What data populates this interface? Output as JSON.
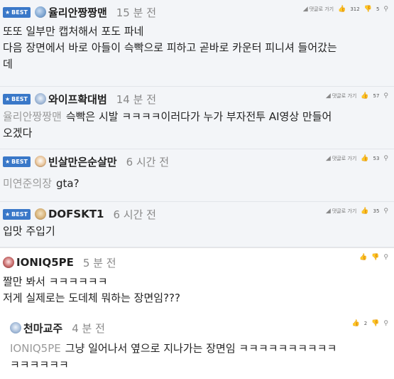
{
  "badge": {
    "label": "BEST",
    "star": "★"
  },
  "actions_labels": {
    "reply": "댓글로 가기"
  },
  "comments": [
    {
      "nick": "율리안짱짱맨",
      "time": "15 분 전",
      "reply_label": "댓글로 가기",
      "likes": "312",
      "dislikes": "5",
      "lines": [
        "또또 일부만 캡처해서 포도 파네",
        "다음 장면에서 바로 아들이 슥빡으로 피하고 곧바로 카운터 피니셔 들어갔는",
        "데"
      ]
    },
    {
      "nick": "와이프확대범",
      "time": "14 분 전",
      "reply_label": "댓글로 가기",
      "likes": "57",
      "mention": "율리안짱짱맨",
      "lines": [
        "슥빡은 시발 ㅋㅋㅋㅋ이러다가 누가 부자전투 AI영상 만들어",
        "오겠다"
      ]
    },
    {
      "nick": "빈살만은순살만",
      "time": "6 시간 전",
      "reply_label": "댓글로 가기",
      "likes": "53",
      "mention": "미연준의장",
      "lines": [
        "gta?"
      ]
    },
    {
      "nick": "DOFSKT1",
      "time": "6 시간 전",
      "reply_label": "댓글로 가기",
      "likes": "35",
      "lines": [
        "입맛 주입기"
      ]
    },
    {
      "nick": "IONIQ5PE",
      "time": "5 분 전",
      "lines": [
        "짤만 봐서 ㅋㅋㅋㅋㅋㅋ",
        "저게 실제로는 도데체 뭐하는 장면임???"
      ]
    },
    {
      "nick": "천마교주",
      "time": "4 분 전",
      "likes": "2",
      "mention": "IONIQ5PE",
      "lines": [
        "그냥 일어나서 옆으로 지나가는 장면임 ㅋㅋㅋㅋㅋㅋㅋㅋㅋㅋ",
        "ㅋㅋㅋㅋㅋㅋ"
      ]
    }
  ],
  "icons": {
    "like": "thumbs-up-icon",
    "dislike": "thumbs-down-icon",
    "link": "link-icon",
    "reply": "reply-arrow-icon"
  }
}
